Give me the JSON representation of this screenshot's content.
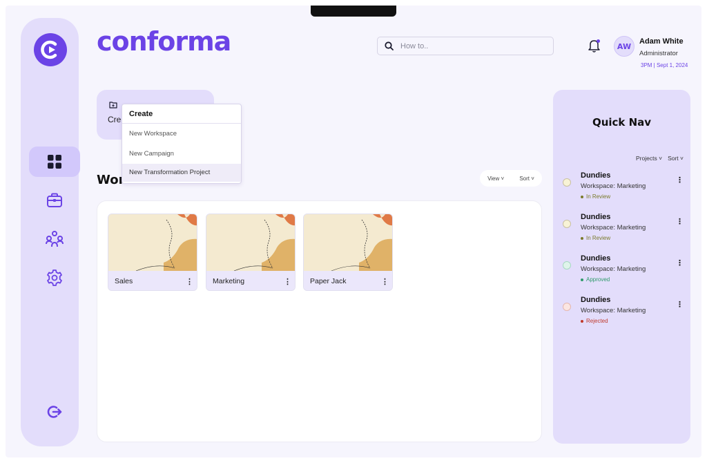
{
  "app": {
    "brand": "conforma"
  },
  "search": {
    "placeholder": "How to.."
  },
  "user": {
    "initials": "AW",
    "name": "Adam White",
    "role": "Administrator",
    "timestamp": "3PM | Sept 1, 2024"
  },
  "create_card": {
    "label": "Cre"
  },
  "create_menu": {
    "title": "Create",
    "items": [
      "New Workspace",
      "New Campaign",
      "New Transformation Project"
    ]
  },
  "workspaces": {
    "title": "Wor",
    "view_label": "View",
    "sort_label": "Sort",
    "cards": [
      {
        "name": "Sales"
      },
      {
        "name": "Marketing"
      },
      {
        "name": "Paper Jack"
      }
    ]
  },
  "quick_nav": {
    "title": "Quick Nav",
    "filter_projects": "Projects",
    "filter_sort": "Sort",
    "items": [
      {
        "name": "Dundies",
        "workspace": "Workspace: Marketing",
        "status": "In Review",
        "status_color": "#7a7a2a",
        "dot_bg": "#f8f3d6",
        "dot_border": "#c9c0a2"
      },
      {
        "name": "Dundies",
        "workspace": "Workspace: Marketing",
        "status": "In Review",
        "status_color": "#7a7a2a",
        "dot_bg": "#f8f3d6",
        "dot_border": "#c9c0a2"
      },
      {
        "name": "Dundies",
        "workspace": "Workspace: Marketing",
        "status": "Approved",
        "status_color": "#2e9a6a",
        "dot_bg": "#dff4ea",
        "dot_border": "#a6d9c1"
      },
      {
        "name": "Dundies",
        "workspace": "Workspace: Marketing",
        "status": "Rejected",
        "status_color": "#c0392b",
        "dot_bg": "#fbe6e2",
        "dot_border": "#e5b7ae"
      }
    ]
  },
  "colors": {
    "accent": "#6b43e6",
    "panel": "#e3ddfb",
    "background": "#f6f5fd"
  },
  "icons": {
    "logo": "conforma-logo-icon",
    "nav": [
      "dashboard-grid-icon",
      "briefcase-icon",
      "team-icon",
      "gear-icon"
    ],
    "logout": "logout-icon",
    "search": "search-icon",
    "notifications": "bell-icon"
  }
}
